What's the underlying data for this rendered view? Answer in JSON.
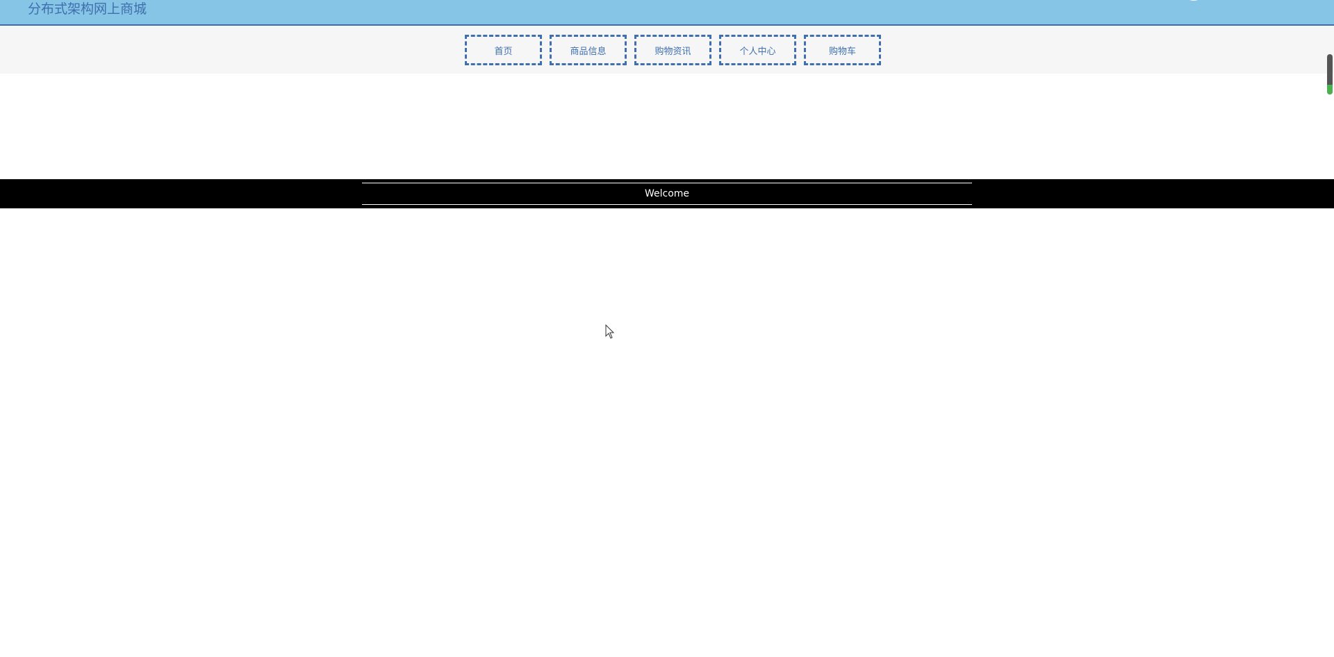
{
  "header": {
    "site_title": "分布式架构网上商城"
  },
  "nav": {
    "items": [
      {
        "label": "首页"
      },
      {
        "label": "商品信息"
      },
      {
        "label": "购物资讯"
      },
      {
        "label": "个人中心"
      },
      {
        "label": "购物车"
      }
    ]
  },
  "banner": {
    "welcome_text": "Welcome"
  },
  "colors": {
    "topbar_bg": "#87c5e6",
    "accent_blue": "#3f6fae",
    "nav_bg": "#f6f6f6",
    "band_bg": "#000000",
    "scroll_accent": "#4caf50"
  },
  "icons": {
    "avatar": "user-avatar",
    "cursor": "mouse-pointer-icon"
  }
}
